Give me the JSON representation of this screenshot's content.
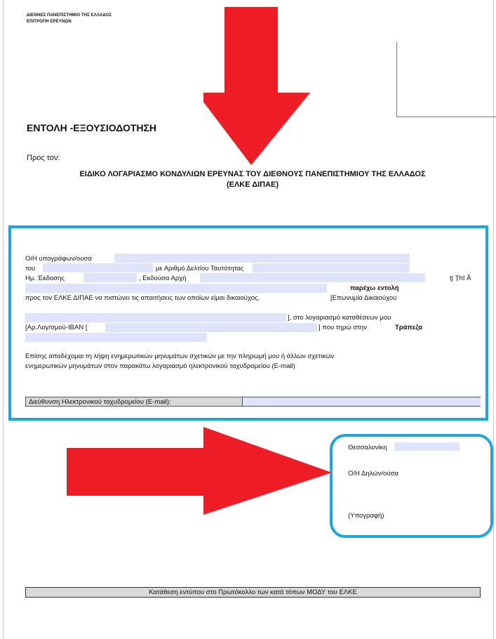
{
  "header": {
    "line1": "ΔΙΕΘΝΕΣ ΠΑΝΕΠΙΣΤΗΜΙΟ ΤΗΣ ΕΛΛΑΔΟΣ",
    "line2": "ΕΠΙΤΡΟΠΗ ΕΡΕΥΝΩΝ"
  },
  "title": "ΕΝΤΟΛΗ -ΕΞΟΥΣΙΟΔΟΤΗΣΗ",
  "to_label": "Προς τον:",
  "recipient": {
    "line1": "ΕΙΔΙΚΟ ΛΟΓΑΡΙΑΣΜΟ ΚΟΝΔΥΛΙΩΝ ΕΡΕΥΝΑΣ ΤΟΥ ΔΙΕΘΝΟΥΣ ΠΑΝΕΠΙΣΤΗΜΙΟΥ ΤΗΣ ΕΛΛΑΔΟΣ",
    "line2": "(ΕΛΚΕ ΔΙΠΑΕ)"
  },
  "form": {
    "signer": "Ο/Η υπογράφων/ουσα",
    "of": "του",
    "id_number": "με Αριθμό Δελτίου Ταυτότητας",
    "issue_date": "Ημ. Έκδοσης",
    "issuing_authority": ", Εκδούσα Αρχή",
    "garbled": "ț| Ţhĭ Â",
    "give_order": "παρέχω εντολή",
    "line_elke": "προς τον ΕΛΚΕ ΔΙΠΑΕ να πιστώνει τις απαιτήσεις των οποίων είμαι δικαιούχος,",
    "beneficiary_name": "[Επωνυμία Δικαιούχου",
    "deposit_account": "], στο λογαριασμό καταθέσεων μου",
    "iban": "[Αρ.Λογ/σμού-IBAN [",
    "held_at": "] που τηρώ στην",
    "bank": "Τράπεζα",
    "consent_line1": "Επίσης αποδέχομαι τη λήψη ενημερωτικών μηνυμάτων σχετικών με την πληρωμή μου ή άλλων σχετικών",
    "consent_line2": "ενημερωτικών μηνυμάτων στον παρακάτω λογαριασμό ηλεκτρονικού ταχυδρομείου (E-mail)",
    "email_label": "Διεύθυνση Ηλεκτρονικού ταχυδρομείου (E-mail):"
  },
  "signature": {
    "place": "Θεσσαλονίκη",
    "declarant": "Ο/Η Δηλών/ούσα",
    "sign_label": "(Υπογραφή)"
  },
  "footer": "Κατάθεση εντύπου στο Πρωτόκολλο των κατά τόπων ΜΟΔΥ του ΕΛΚΕ",
  "colors": {
    "annotation_blue": "#1aa6e2",
    "arrow_red": "#ee1c25",
    "field_fill": "#dfe4fc"
  }
}
